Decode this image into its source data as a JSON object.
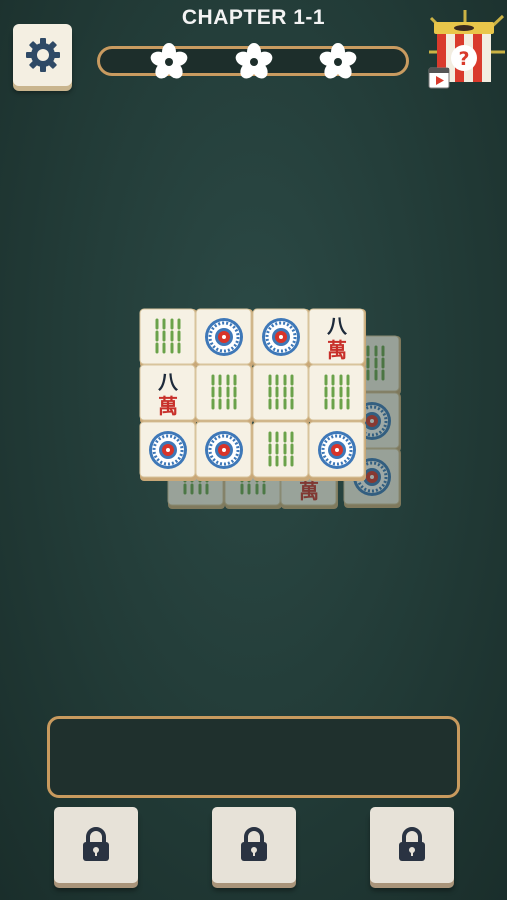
{
  "header": {
    "title": "CHAPTER 1-1",
    "settings_icon": "gear-icon",
    "hint_icon": "hint-box-icon"
  },
  "progress": {
    "stars_total": 3,
    "star_icon": "sakura-flower-icon",
    "value": 0
  },
  "tiles": {
    "top_layer": [
      [
        "bamboo-8",
        "circle-1",
        "circle-1",
        "character-8-wan"
      ],
      [
        "character-8-wan",
        "bamboo-8",
        "bamboo-8",
        "bamboo-8"
      ],
      [
        "circle-1",
        "circle-1",
        "bamboo-8",
        "circle-1"
      ]
    ],
    "character_glyphs": {
      "number": "八",
      "suit": "萬"
    }
  },
  "slots": [
    {
      "state": "locked",
      "icon": "lock-icon"
    },
    {
      "state": "locked",
      "icon": "lock-icon"
    },
    {
      "state": "locked",
      "icon": "lock-icon"
    }
  ],
  "colors": {
    "background": "#223b37",
    "accent_border": "#c99b60",
    "tile_face": "#f6f1e4",
    "tile_side": "#c9a878"
  }
}
